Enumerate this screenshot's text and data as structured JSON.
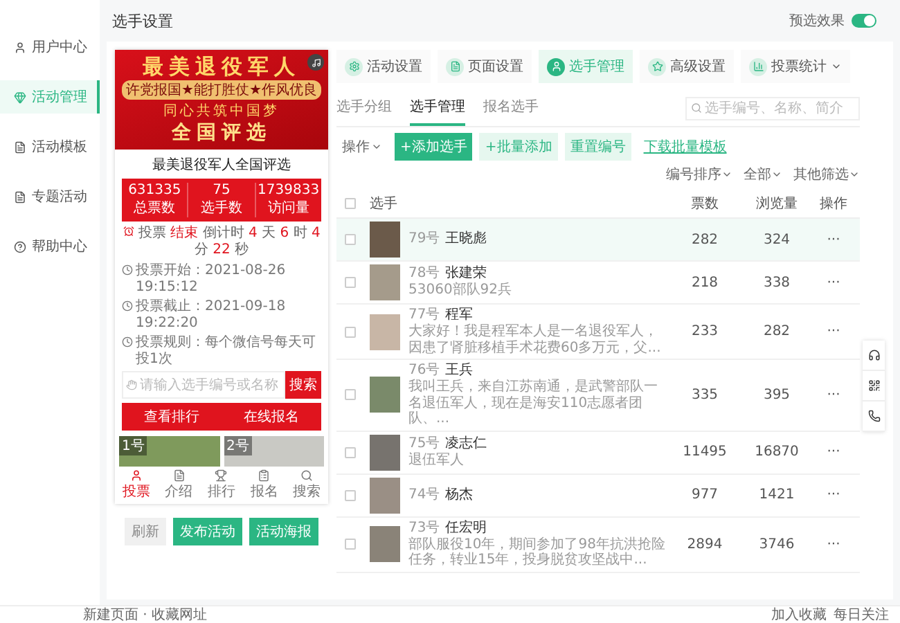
{
  "sidebar": {
    "items": [
      {
        "label": "用户中心",
        "selected": false
      },
      {
        "label": "活动管理",
        "selected": true
      },
      {
        "label": "活动模板",
        "selected": false
      },
      {
        "label": "专题活动",
        "selected": false
      },
      {
        "label": "帮助中心",
        "selected": false
      }
    ]
  },
  "header": {
    "title": "选手设置",
    "preview_label": "预选效果",
    "preview_on": true
  },
  "preview": {
    "banner": {
      "title": "最美退役军人",
      "slogan": "许党报国★能打胜仗★作风优良",
      "motto": "同心共筑中国梦",
      "subtitle": "全国评选"
    },
    "activity_title": "最美退役军人全国评选",
    "stats": [
      {
        "value": "631335",
        "label": "总票数"
      },
      {
        "value": "75",
        "label": "选手数"
      },
      {
        "value": "1739833",
        "label": "访问量"
      }
    ],
    "countdown": [
      {
        "text": "投票",
        "highlight": false
      },
      {
        "text": "结束",
        "highlight": true
      },
      {
        "text": "倒计时",
        "highlight": false
      },
      {
        "text": "4",
        "highlight": true
      },
      {
        "text": "天",
        "highlight": false
      },
      {
        "text": "6",
        "highlight": true
      },
      {
        "text": "时",
        "highlight": false
      },
      {
        "text": "4",
        "highlight": true
      },
      {
        "text": "分",
        "highlight": false
      },
      {
        "text": "22",
        "highlight": true
      },
      {
        "text": "秒",
        "highlight": false
      }
    ],
    "info": [
      "投票开始：2021-08-26 19:15:12",
      "投票截止：2021-09-18 19:22:20",
      "投票规则：每个微信号每天可投1次"
    ],
    "search": {
      "placeholder": "请输入选手编号或名称",
      "button": "搜索"
    },
    "actions": [
      "查看排行",
      "在线报名"
    ],
    "photos": [
      {
        "label": "1号"
      },
      {
        "label": "2号"
      }
    ],
    "nav": [
      {
        "label": "投票",
        "selected": true
      },
      {
        "label": "介绍",
        "selected": false
      },
      {
        "label": "排行",
        "selected": false
      },
      {
        "label": "报名",
        "selected": false
      },
      {
        "label": "搜索",
        "selected": false
      }
    ]
  },
  "preview_buttons": [
    {
      "label": "刷新",
      "kind": "plain"
    },
    {
      "label": "发布活动",
      "kind": "primary"
    },
    {
      "label": "活动海报",
      "kind": "primary"
    }
  ],
  "tabs": [
    {
      "label": "活动设置",
      "selected": false,
      "has_menu": false
    },
    {
      "label": "页面设置",
      "selected": false,
      "has_menu": false
    },
    {
      "label": "选手管理",
      "selected": true,
      "has_menu": false
    },
    {
      "label": "高级设置",
      "selected": false,
      "has_menu": false
    },
    {
      "label": "投票统计",
      "selected": false,
      "has_menu": true
    }
  ],
  "subtabs": [
    {
      "label": "选手分组",
      "selected": false
    },
    {
      "label": "选手管理",
      "selected": true
    },
    {
      "label": "报名选手",
      "selected": false
    }
  ],
  "search": {
    "placeholder": "选手编号、名称、简介"
  },
  "toolbar": {
    "left": [
      {
        "label": "操作",
        "kind": "menu"
      },
      {
        "label": "+添加选手",
        "kind": "primary"
      },
      {
        "label": "+批量添加",
        "kind": "light"
      },
      {
        "label": "重置编号",
        "kind": "light"
      },
      {
        "label": "下载批量模板",
        "kind": "link"
      }
    ],
    "right": [
      "编号排序",
      "全部",
      "其他筛选"
    ]
  },
  "table": {
    "select_all_checked": false,
    "columns": [
      "选手",
      "票数",
      "浏览量",
      "操作"
    ],
    "rows": [
      {
        "number": "79号",
        "name": "王晓彪",
        "description": "",
        "votes": "282",
        "views": "324",
        "action": "···",
        "selected": true,
        "checked": false
      },
      {
        "number": "78号",
        "name": "张建荣",
        "description": "53060部队92兵",
        "votes": "218",
        "views": "338",
        "action": "···",
        "selected": false,
        "checked": false
      },
      {
        "number": "77号",
        "name": "程军",
        "description": "大家好！我是程军本人是一名退役军人，因患了肾脏移植手术花费60多万元，父...",
        "votes": "233",
        "views": "282",
        "action": "···",
        "selected": false,
        "checked": false
      },
      {
        "number": "76号",
        "name": "王兵",
        "description": "我叫王兵，来自江苏南通，是武警部队一名退伍军人，现在是海安110志愿者团队、...",
        "votes": "335",
        "views": "395",
        "action": "···",
        "selected": false,
        "checked": false
      },
      {
        "number": "75号",
        "name": "凌志仁",
        "description": "退伍军人",
        "votes": "11495",
        "views": "16870",
        "action": "···",
        "selected": false,
        "checked": false
      },
      {
        "number": "74号",
        "name": "杨杰",
        "description": "",
        "votes": "977",
        "views": "1421",
        "action": "···",
        "selected": false,
        "checked": false
      },
      {
        "number": "73号",
        "name": "任宏明",
        "description": "部队服役10年，期间参加了98年抗洪抢险任务，转业15年，投身脱贫攻坚战中...",
        "votes": "2894",
        "views": "3746",
        "action": "···",
        "selected": false,
        "checked": false
      }
    ]
  },
  "status_bar": {
    "left": [
      "新建页面 · 收藏网址"
    ],
    "right": [
      "加入收藏",
      "每日关注"
    ]
  }
}
